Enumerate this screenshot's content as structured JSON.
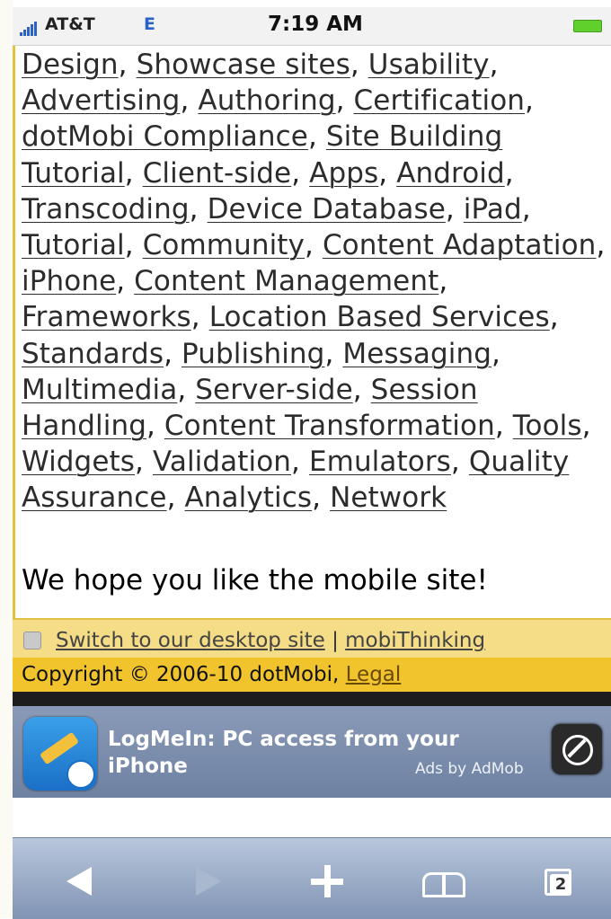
{
  "status_bar": {
    "carrier": "AT&T",
    "network": "E",
    "time": "7:19 AM"
  },
  "tags": [
    "Design",
    "Showcase sites",
    "Usability",
    "Advertising",
    "Authoring",
    "Certification",
    "dotMobi Compliance",
    "Site Building Tutorial",
    "Client-side",
    "Apps",
    "Android",
    "Transcoding",
    "Device Database",
    "iPad",
    "Tutorial",
    "Community",
    "Content Adaptation",
    "iPhone",
    "Content Management",
    "Frameworks",
    "Location Based Services",
    "Standards",
    "Publishing",
    "Messaging",
    "Multimedia",
    "Server-side",
    "Session Handling",
    "Content Transformation",
    "Tools",
    "Widgets",
    "Validation",
    "Emulators",
    "Quality Assurance",
    "Analytics",
    "Network"
  ],
  "message": "We hope you like the mobile site!",
  "footer": {
    "desktop_link": "Switch to our desktop site",
    "separator": "|",
    "mobithinking_link": "mobiThinking",
    "copyright": "Copyright © 2006-10 dotMobi,",
    "legal_link": "Legal"
  },
  "ad": {
    "title_line1": "LogMeIn: PC access from your",
    "title_line2": "iPhone",
    "attribution": "Ads by AdMob",
    "icon": "logmein-app-icon",
    "action_icon": "compass-icon"
  },
  "toolbar": {
    "icons": [
      "back-icon",
      "forward-icon",
      "add-icon",
      "bookmarks-icon",
      "pages-icon"
    ],
    "pages_count": "2"
  },
  "colors": {
    "link_bar_bg": "#f4dd86",
    "copyright_bar_bg": "#f1c42d",
    "ad_banner_bg": "#7d8fae",
    "toolbar_bg": "#9fb0cb"
  }
}
